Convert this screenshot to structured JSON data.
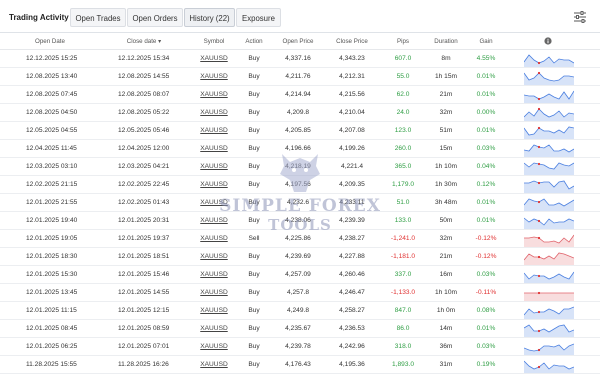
{
  "tabs": {
    "title": "Trading Activity",
    "open_trades": "Open Trades",
    "open_orders": "Open Orders",
    "history": "History (22)",
    "exposure": "Exposure"
  },
  "columns": {
    "open_date": "Open Date",
    "close_date": "Close date ▾",
    "symbol": "Symbol",
    "action": "Action",
    "open_price": "Open Price",
    "close_price": "Close Price",
    "pips": "Pips",
    "duration": "Duration",
    "gain": "Gain",
    "info_icon": "info-icon"
  },
  "colors": {
    "positive": "#2f9e44",
    "negative": "#e03131",
    "spark_blue": "#4a7fe0",
    "spark_red": "#e0636b"
  },
  "rows": [
    {
      "open": "12.12.2025 15:25",
      "close": "12.12.2025 15:34",
      "symbol": "XAUUSD",
      "action": "Buy",
      "open_price": "4,337.16",
      "close_price": "4,343.23",
      "pips": "607.0",
      "duration": "8m",
      "gain": "4.55%",
      "sign": "pos"
    },
    {
      "open": "12.08.2025 13:40",
      "close": "12.08.2025 14:55",
      "symbol": "XAUUSD",
      "action": "Buy",
      "open_price": "4,211.76",
      "close_price": "4,212.31",
      "pips": "55.0",
      "duration": "1h 15m",
      "gain": "0.01%",
      "sign": "pos"
    },
    {
      "open": "12.08.2025 07:45",
      "close": "12.08.2025 08:07",
      "symbol": "XAUUSD",
      "action": "Buy",
      "open_price": "4,214.94",
      "close_price": "4,215.56",
      "pips": "62.0",
      "duration": "21m",
      "gain": "0.01%",
      "sign": "pos"
    },
    {
      "open": "12.08.2025 04:50",
      "close": "12.08.2025 05:22",
      "symbol": "XAUUSD",
      "action": "Buy",
      "open_price": "4,209.8",
      "close_price": "4,210.04",
      "pips": "24.0",
      "duration": "32m",
      "gain": "0.00%",
      "sign": "pos"
    },
    {
      "open": "12.05.2025 04:55",
      "close": "12.05.2025 05:46",
      "symbol": "XAUUSD",
      "action": "Buy",
      "open_price": "4,205.85",
      "close_price": "4,207.08",
      "pips": "123.0",
      "duration": "51m",
      "gain": "0.01%",
      "sign": "pos"
    },
    {
      "open": "12.04.2025 11:45",
      "close": "12.04.2025 12:00",
      "symbol": "XAUUSD",
      "action": "Buy",
      "open_price": "4,196.66",
      "close_price": "4,199.26",
      "pips": "260.0",
      "duration": "15m",
      "gain": "0.03%",
      "sign": "pos"
    },
    {
      "open": "12.03.2025 03:10",
      "close": "12.03.2025 04:21",
      "symbol": "XAUUSD",
      "action": "Buy",
      "open_price": "4,218.19",
      "close_price": "4,221.4",
      "pips": "365.0",
      "duration": "1h 10m",
      "gain": "0.04%",
      "sign": "pos"
    },
    {
      "open": "12.02.2025 21:15",
      "close": "12.02.2025 22:45",
      "symbol": "XAUUSD",
      "action": "Buy",
      "open_price": "4,197.56",
      "close_price": "4,209.35",
      "pips": "1,179.0",
      "duration": "1h 30m",
      "gain": "0.12%",
      "sign": "pos"
    },
    {
      "open": "12.01.2025 21:55",
      "close": "12.02.2025 01:43",
      "symbol": "XAUUSD",
      "action": "Buy",
      "open_price": "4,232.6",
      "close_price": "4,233.11",
      "pips": "51.0",
      "duration": "3h 48m",
      "gain": "0.01%",
      "sign": "pos"
    },
    {
      "open": "12.01.2025 19:40",
      "close": "12.01.2025 20:31",
      "symbol": "XAUUSD",
      "action": "Buy",
      "open_price": "4,238.06",
      "close_price": "4,239.39",
      "pips": "133.0",
      "duration": "50m",
      "gain": "0.01%",
      "sign": "pos"
    },
    {
      "open": "12.01.2025 19:05",
      "close": "12.01.2025 19:37",
      "symbol": "XAUUSD",
      "action": "Sell",
      "open_price": "4,225.86",
      "close_price": "4,238.27",
      "pips": "-1,241.0",
      "duration": "32m",
      "gain": "-0.12%",
      "sign": "neg"
    },
    {
      "open": "12.01.2025 18:30",
      "close": "12.01.2025 18:51",
      "symbol": "XAUUSD",
      "action": "Buy",
      "open_price": "4,239.69",
      "close_price": "4,227.88",
      "pips": "-1,181.0",
      "duration": "21m",
      "gain": "-0.12%",
      "sign": "neg"
    },
    {
      "open": "12.01.2025 15:30",
      "close": "12.01.2025 15:46",
      "symbol": "XAUUSD",
      "action": "Buy",
      "open_price": "4,257.09",
      "close_price": "4,260.46",
      "pips": "337.0",
      "duration": "16m",
      "gain": "0.03%",
      "sign": "pos"
    },
    {
      "open": "12.01.2025 13:45",
      "close": "12.01.2025 14:55",
      "symbol": "XAUUSD",
      "action": "Buy",
      "open_price": "4,257.8",
      "close_price": "4,246.47",
      "pips": "-1,133.0",
      "duration": "1h 10m",
      "gain": "-0.11%",
      "sign": "neg"
    },
    {
      "open": "12.01.2025 11:15",
      "close": "12.01.2025 12:15",
      "symbol": "XAUUSD",
      "action": "Buy",
      "open_price": "4,249.8",
      "close_price": "4,258.27",
      "pips": "847.0",
      "duration": "1h 0m",
      "gain": "0.08%",
      "sign": "pos"
    },
    {
      "open": "12.01.2025 08:45",
      "close": "12.01.2025 08:59",
      "symbol": "XAUUSD",
      "action": "Buy",
      "open_price": "4,235.67",
      "close_price": "4,236.53",
      "pips": "86.0",
      "duration": "14m",
      "gain": "0.01%",
      "sign": "pos"
    },
    {
      "open": "12.01.2025 06:25",
      "close": "12.01.2025 07:01",
      "symbol": "XAUUSD",
      "action": "Buy",
      "open_price": "4,239.78",
      "close_price": "4,242.96",
      "pips": "318.0",
      "duration": "36m",
      "gain": "0.03%",
      "sign": "pos"
    },
    {
      "open": "11.28.2025 15:55",
      "close": "11.28.2025 16:26",
      "symbol": "XAUUSD",
      "action": "Buy",
      "open_price": "4,176.43",
      "close_price": "4,195.36",
      "pips": "1,893.0",
      "duration": "31m",
      "gain": "0.19%",
      "sign": "pos"
    }
  ],
  "watermark": {
    "line1": "SIMPLE FOREX",
    "line2": "TOOLS"
  }
}
